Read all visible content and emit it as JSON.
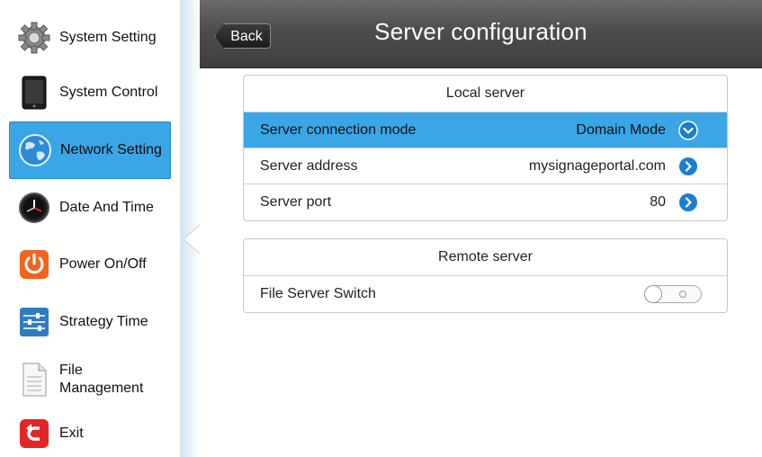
{
  "sidebar": {
    "items": [
      {
        "label": "System Setting",
        "icon": "gear-icon"
      },
      {
        "label": "System Control",
        "icon": "tablet-icon"
      },
      {
        "label": "Network Setting",
        "icon": "globe-icon",
        "active": true
      },
      {
        "label": "Date And Time",
        "icon": "clock-icon"
      },
      {
        "label": "Power On/Off",
        "icon": "power-icon"
      },
      {
        "label": "Strategy Time",
        "icon": "sliders-icon"
      },
      {
        "label_line1": "File",
        "label_line2": "Management",
        "icon": "document-icon"
      },
      {
        "label": "Exit",
        "icon": "exit-icon"
      }
    ]
  },
  "header": {
    "title": "Server configuration",
    "back_label": "Back"
  },
  "local_server": {
    "title": "Local server",
    "rows": [
      {
        "label": "Server connection mode",
        "value": "Domain Mode",
        "icon": "chevron-down-icon",
        "selected": true
      },
      {
        "label": "Server address",
        "value": "mysignageportal.com",
        "icon": "chevron-right-icon"
      },
      {
        "label": "Server port",
        "value": "80",
        "icon": "chevron-right-icon"
      }
    ]
  },
  "remote_server": {
    "title": "Remote server",
    "rows": [
      {
        "label": "File Server Switch",
        "toggle": "off"
      }
    ]
  },
  "colors": {
    "accent": "#3aa6e6",
    "header_bg": "#4d4d4d",
    "chevron_blue": "#1b7fd0"
  }
}
